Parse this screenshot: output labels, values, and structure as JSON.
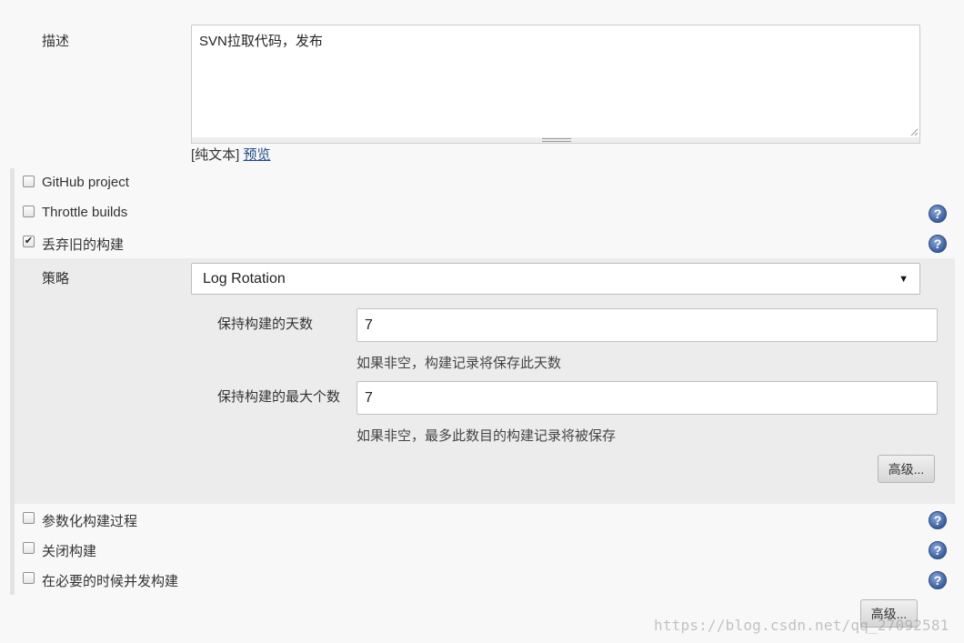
{
  "description": {
    "label": "描述",
    "value": "SVN拉取代码，发布",
    "format_prefix": "[纯文本]",
    "preview_link": "预览"
  },
  "options": {
    "github_project": {
      "label": "GitHub project",
      "checked": false
    },
    "throttle_builds": {
      "label": "Throttle builds",
      "checked": false
    },
    "discard_old": {
      "label": "丢弃旧的构建",
      "checked": true
    }
  },
  "strategy": {
    "label": "策略",
    "selected": "Log Rotation",
    "days_label": "保持构建的天数",
    "days_value": "7",
    "days_hint": "如果非空，构建记录将保存此天数",
    "max_label": "保持构建的最大个数",
    "max_value": "7",
    "max_hint": "如果非空，最多此数目的构建记录将被保存",
    "advanced_button": "高级..."
  },
  "more_options": {
    "parameterized": {
      "label": "参数化构建过程",
      "checked": false
    },
    "disable_build": {
      "label": "关闭构建",
      "checked": false
    },
    "concurrent": {
      "label": "在必要的时候并发构建",
      "checked": false
    }
  },
  "footer": {
    "advanced_button": "高级...",
    "watermark": "https://blog.csdn.net/qq_27092581"
  },
  "icons": {
    "help": "help-icon",
    "checkmark": "✔",
    "dropdown": "▼"
  },
  "colors": {
    "link": "#204a87",
    "help_icon": "#3b5f9e"
  }
}
